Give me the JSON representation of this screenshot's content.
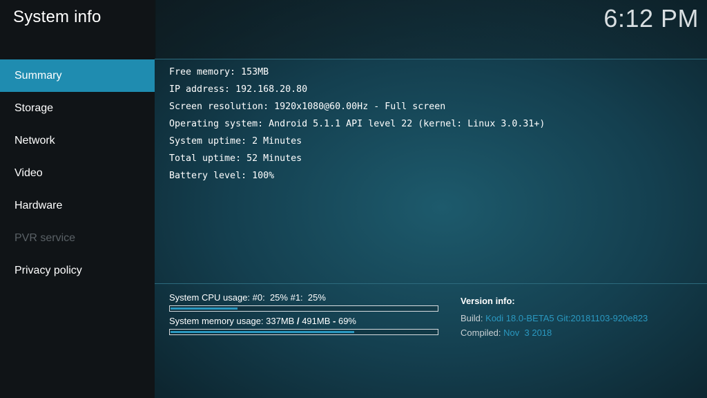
{
  "header": {
    "title": "System info",
    "clock": "6:12 PM"
  },
  "sidebar": {
    "items": [
      {
        "label": "Summary",
        "state": "active"
      },
      {
        "label": "Storage",
        "state": "normal"
      },
      {
        "label": "Network",
        "state": "normal"
      },
      {
        "label": "Video",
        "state": "normal"
      },
      {
        "label": "Hardware",
        "state": "normal"
      },
      {
        "label": "PVR service",
        "state": "disabled"
      },
      {
        "label": "Privacy policy",
        "state": "normal"
      }
    ]
  },
  "summary": {
    "lines": [
      "Free memory: 153MB",
      "IP address: 192.168.20.80",
      "Screen resolution: 1920x1080@60.00Hz - Full screen",
      "Operating system: Android 5.1.1 API level 22 (kernel: Linux 3.0.31+)",
      "System uptime: 2 Minutes",
      "Total uptime: 52 Minutes",
      "Battery level: 100%"
    ]
  },
  "usage": {
    "cpu_label": "System CPU usage: #0:  25% #1:  25%",
    "cpu_percent": 25,
    "memory_prefix": "System memory usage: 337MB ",
    "memory_sep1": "/",
    "memory_total": " 491MB ",
    "memory_sep2": "-",
    "memory_pct_text": " 69%",
    "memory_percent": 69
  },
  "version": {
    "title": "Version info:",
    "build_label": "Build:",
    "build_value": "Kodi 18.0-BETA5 Git:20181103-920e823",
    "compiled_label": "Compiled:",
    "compiled_value": "Nov  3 2018"
  },
  "colors": {
    "accent": "#1f8cb0",
    "bar_fill": "#2a98c0",
    "sidebar_bg": "#101417",
    "disabled_text": "#5a6166"
  }
}
